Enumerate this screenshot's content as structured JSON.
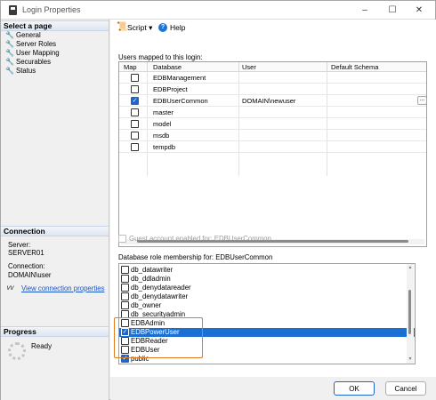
{
  "window": {
    "title": "Login Properties"
  },
  "left_panel": {
    "select_page_header": "Select a page",
    "pages": [
      "General",
      "Server Roles",
      "User Mapping",
      "Securables",
      "Status"
    ],
    "connection_header": "Connection",
    "server_label": "Server:",
    "server_value": "SERVER01",
    "connection_label": "Connection:",
    "connection_value": "DOMAIN\\user",
    "view_link": "View connection properties",
    "progress_header": "Progress",
    "progress_status": "Ready"
  },
  "toolbar": {
    "script_label": "Script",
    "help_label": "Help"
  },
  "users_section": {
    "label": "Users mapped to this login:",
    "columns": [
      "Map",
      "Database",
      "User",
      "Default Schema"
    ],
    "rows": [
      {
        "map": false,
        "database": "EDBManagement",
        "user": "",
        "schema": ""
      },
      {
        "map": false,
        "database": "EDBProject",
        "user": "",
        "schema": ""
      },
      {
        "map": true,
        "database": "EDBUserCommon",
        "user": "DOMAIN\\newuser",
        "schema": ""
      },
      {
        "map": false,
        "database": "master",
        "user": "",
        "schema": ""
      },
      {
        "map": false,
        "database": "model",
        "user": "",
        "schema": ""
      },
      {
        "map": false,
        "database": "msdb",
        "user": "",
        "schema": ""
      },
      {
        "map": false,
        "database": "tempdb",
        "user": "",
        "schema": ""
      }
    ],
    "ellipsis_label": "..."
  },
  "guest_label": "Guest account enabled for: EDBUserCommon",
  "roles_section": {
    "label": "Database role membership for: EDBUserCommon",
    "roles": [
      {
        "name": "db_datawriter",
        "checked": false,
        "selected": false
      },
      {
        "name": "db_ddladmin",
        "checked": false,
        "selected": false
      },
      {
        "name": "db_denydatareader",
        "checked": false,
        "selected": false
      },
      {
        "name": "db_denydatawriter",
        "checked": false,
        "selected": false
      },
      {
        "name": "db_owner",
        "checked": false,
        "selected": false
      },
      {
        "name": "db_securityadmin",
        "checked": false,
        "selected": false
      },
      {
        "name": "EDBAdmin",
        "checked": false,
        "selected": false
      },
      {
        "name": "EDBPowerUser",
        "checked": true,
        "selected": true
      },
      {
        "name": "EDBReader",
        "checked": false,
        "selected": false
      },
      {
        "name": "EDBUser",
        "checked": false,
        "selected": false
      },
      {
        "name": "public",
        "checked": true,
        "selected": false
      }
    ]
  },
  "footer": {
    "ok_label": "OK",
    "cancel_label": "Cancel"
  },
  "colors": {
    "accent": "#1e66c9",
    "selection": "#1b6ed2",
    "highlight": "#e07b1e"
  },
  "icons": [
    "app-icon",
    "wrench-icon",
    "script-icon",
    "help-icon",
    "link-icon",
    "spinner-icon"
  ]
}
